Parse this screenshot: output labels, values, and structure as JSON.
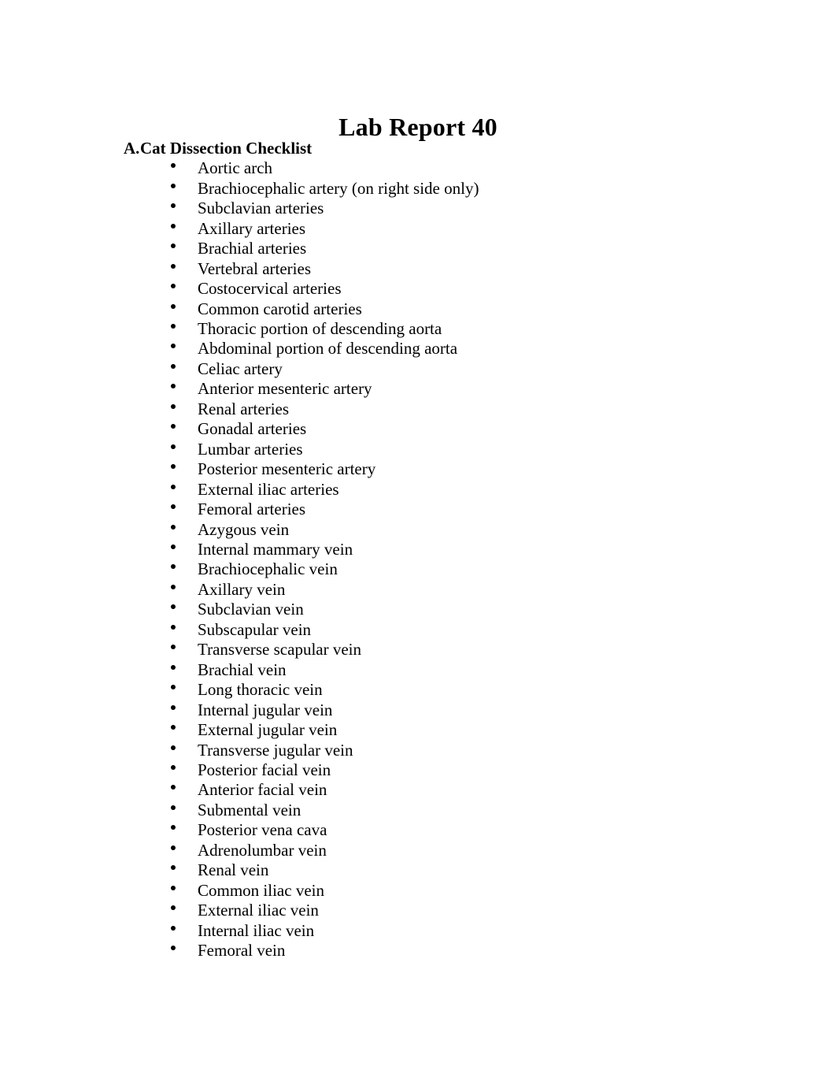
{
  "document": {
    "title": "Lab Report 40"
  },
  "section": {
    "letter": "A.",
    "heading": "Cat Dissection Checklist",
    "items": [
      "Aortic arch",
      "Brachiocephalic artery (on right side only)",
      "Subclavian arteries",
      "Axillary arteries",
      "Brachial arteries",
      "Vertebral arteries",
      "Costocervical arteries",
      "Common carotid arteries",
      "Thoracic portion of descending aorta",
      "Abdominal portion of descending aorta",
      "Celiac artery",
      "Anterior mesenteric artery",
      "Renal arteries",
      "Gonadal arteries",
      "Lumbar arteries",
      "Posterior mesenteric artery",
      "External iliac arteries",
      "Femoral arteries",
      "Azygous vein",
      "Internal mammary vein",
      "Brachiocephalic vein",
      "Axillary vein",
      "Subclavian vein",
      "Subscapular vein",
      "Transverse scapular vein",
      "Brachial vein",
      "Long thoracic vein",
      "Internal jugular vein",
      "External jugular vein",
      "Transverse jugular vein",
      "Posterior facial vein",
      "Anterior facial vein",
      "Submental vein",
      "Posterior vena cava",
      "Adrenolumbar vein",
      "Renal vein",
      "Common iliac vein",
      "External iliac vein",
      "Internal iliac vein",
      "Femoral vein"
    ]
  },
  "colors": {
    "page_background": "#ffffff",
    "text": "#000000"
  }
}
